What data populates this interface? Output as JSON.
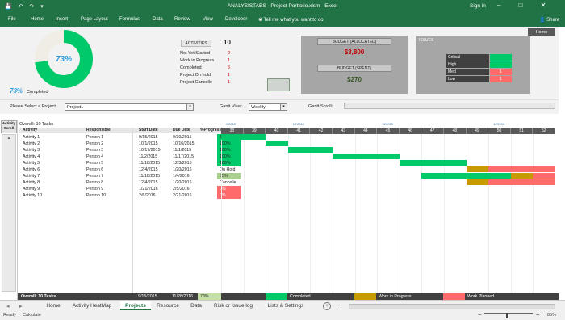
{
  "app": {
    "quick_access": "💾 ↶ ↷ ▾",
    "title": "ANALYSISTABS - Project Portfolio.xlsm - Excel",
    "sign_in": "Sign in",
    "window_controls": "‒ □ ✕",
    "menu": [
      "File",
      "Home",
      "Insert",
      "Page Layout",
      "Formulas",
      "Data",
      "Review",
      "View",
      "Developer"
    ],
    "tell_me": "❀ Tell me what you want to do",
    "share": "👤 Share"
  },
  "colors": {
    "green": "#00c96a",
    "red": "#ff6b6b",
    "gold": "#c79a00",
    "excel": "#217346"
  },
  "dashboard": {
    "home_button": "Home",
    "donut_percent": "73%",
    "donut_fraction": 0.73,
    "completed_percent": "73%",
    "completed_label": "Completed",
    "activities_label": "ACTIVITIES",
    "activities_total": "10",
    "stats": [
      {
        "label": "Not Yet Started",
        "value": "2"
      },
      {
        "label": "Work in Progress",
        "value": "1"
      },
      {
        "label": "Completed",
        "value": "5"
      },
      {
        "label": "Project On hold",
        "value": "1"
      },
      {
        "label": "Project Cancelle",
        "value": "1"
      }
    ],
    "budget_allocated_label": "BUDGET (ALLOCATED)",
    "budget_allocated_value": "$3,800",
    "budget_spent_label": "BUDGET (SPENT)",
    "budget_spent_value": "$270",
    "issues_label": "ISSUES",
    "issues": [
      {
        "label": "Critical",
        "value": "",
        "color": "green"
      },
      {
        "label": "High",
        "value": "",
        "color": "green"
      },
      {
        "label": "Med",
        "value": "1",
        "color": "red"
      },
      {
        "label": "Low",
        "value": "1",
        "color": "red"
      }
    ]
  },
  "selectors": {
    "project_label": "Please Select a Project:",
    "project_value": "Project1",
    "gantt_view_label": "Gantt View:",
    "gantt_view_value": "Weekly",
    "gantt_scroll_label": "Gantt Scroll:",
    "dropdown_glyph": "▾"
  },
  "side": {
    "activity_scroll": "Activity Scroll",
    "up_arrow": "▴"
  },
  "table": {
    "overall_label": "Overall: 10 Tasks",
    "headers": [
      "Activity",
      "Responsible",
      "Start Date",
      "Due Date",
      "%Progress"
    ],
    "rows": [
      {
        "activity": "Activity 1",
        "person": "Person 1",
        "start": "9/15/2015",
        "due": "9/30/2015",
        "progress": "100%",
        "status": "green"
      },
      {
        "activity": "Activity 2",
        "person": "Person 2",
        "start": "10/1/2015",
        "due": "10/16/2015",
        "progress": "100%",
        "status": "green"
      },
      {
        "activity": "Activity 3",
        "person": "Person 3",
        "start": "10/17/2015",
        "due": "11/1/2015",
        "progress": "100%",
        "status": "green"
      },
      {
        "activity": "Activity 4",
        "person": "Person 4",
        "start": "11/2/2015",
        "due": "11/17/2015",
        "progress": "100%",
        "status": "green"
      },
      {
        "activity": "Activity 5",
        "person": "Person 5",
        "start": "11/18/2015",
        "due": "12/3/2015",
        "progress": "100%",
        "status": "green"
      },
      {
        "activity": "Activity 6",
        "person": "Person 6",
        "start": "12/4/2015",
        "due": "1/20/2016",
        "progress": "On Hold",
        "status": "none"
      },
      {
        "activity": "Activity 7",
        "person": "Person 7",
        "start": "11/18/2015",
        "due": "1/4/2016",
        "progress": "85%",
        "status": "lightgreen"
      },
      {
        "activity": "Activity 8",
        "person": "Person 8",
        "start": "12/4/2015",
        "due": "1/20/2016",
        "progress": "Cancelle",
        "status": "none"
      },
      {
        "activity": "Activity 9",
        "person": "Person 9",
        "start": "1/21/2016",
        "due": "2/5/2016",
        "progress": "0%",
        "status": "red"
      },
      {
        "activity": "Activity 10",
        "person": "Person 10",
        "start": "2/6/2016",
        "due": "2/21/2016",
        "progress": "0%",
        "status": "red"
      }
    ],
    "footer": {
      "overall": "Overall: 10 Tasks",
      "start": "9/15/2015",
      "due": "11/28/2016",
      "progress": "73%"
    }
  },
  "gantt": {
    "months": [
      {
        "label": "9'2015",
        "col": 0
      },
      {
        "label": "10'2015",
        "col": 3
      },
      {
        "label": "11'2015",
        "col": 7
      },
      {
        "label": "12'2015",
        "col": 12
      }
    ],
    "weeks": [
      "38",
      "39",
      "40",
      "41",
      "42",
      "43",
      "44",
      "45",
      "46",
      "47",
      "48",
      "49",
      "50",
      "51",
      "52"
    ],
    "bars": [
      {
        "row": 0,
        "start": 0,
        "len": 2,
        "color": "green"
      },
      {
        "row": 1,
        "start": 2,
        "len": 1,
        "color": "green"
      },
      {
        "row": 2,
        "start": 3,
        "len": 2,
        "color": "green"
      },
      {
        "row": 3,
        "start": 5,
        "len": 3,
        "color": "green"
      },
      {
        "row": 4,
        "start": 8,
        "len": 3,
        "color": "green"
      },
      {
        "row": 5,
        "start": 11,
        "len": 1,
        "color": "gold"
      },
      {
        "row": 5,
        "start": 12,
        "len": 3,
        "color": "red"
      },
      {
        "row": 6,
        "start": 9,
        "len": 4,
        "color": "green"
      },
      {
        "row": 6,
        "start": 13,
        "len": 1,
        "color": "gold"
      },
      {
        "row": 6,
        "start": 14,
        "len": 1,
        "color": "red"
      },
      {
        "row": 7,
        "start": 11,
        "len": 1,
        "color": "gold"
      },
      {
        "row": 7,
        "start": 12,
        "len": 3,
        "color": "red"
      }
    ],
    "legend": [
      {
        "label": "Completed",
        "color": "green"
      },
      {
        "label": "Work in Progress",
        "color": "gold"
      },
      {
        "label": "Work Planned",
        "color": "red"
      }
    ]
  },
  "sheet_tabs": {
    "nav_prev": "◂",
    "nav_next": "▸",
    "items": [
      "Home",
      "Activity HeatMap",
      "Projects",
      "Resource",
      "Data",
      "Risk or Issue log",
      "Lists & Settings"
    ],
    "active": "Projects",
    "add": "+",
    "more": "…"
  },
  "status_bar": {
    "ready": "Ready",
    "calculate": "Calculate",
    "zoom": "85%",
    "zoom_out": "−",
    "zoom_in": "+"
  }
}
